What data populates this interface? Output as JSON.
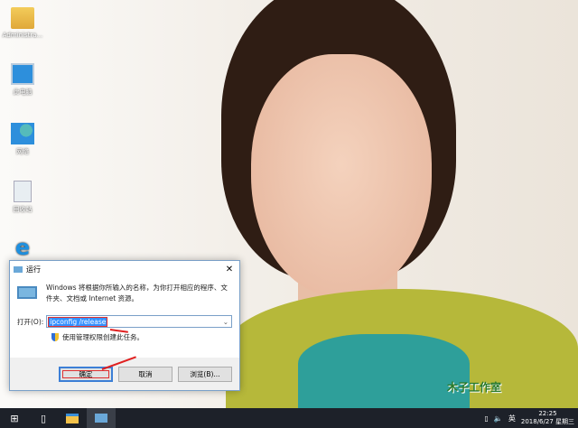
{
  "desktop": {
    "icons": [
      {
        "label": "Administra..."
      },
      {
        "label": "此电脑"
      },
      {
        "label": "网络"
      },
      {
        "label": "回收站"
      }
    ],
    "watermark": "木子工作室"
  },
  "run_dialog": {
    "title": "运行",
    "close": "✕",
    "description": "Windows 将根据你所输入的名称，为你打开相应的程序、文件夹、文档或 Internet 资源。",
    "open_label": "打开(O):",
    "command": "ipconfig /release",
    "admin_note": "使用管理权限创建此任务。",
    "ok": "确定",
    "cancel": "取消",
    "browse": "浏览(B)..."
  },
  "taskbar": {
    "tray_lang": "英",
    "time": "22:25",
    "date": "2018/6/27 星期三"
  },
  "colors": {
    "accent": "#3390ff",
    "annotation": "#e02020",
    "taskbar": "#1d2129"
  }
}
